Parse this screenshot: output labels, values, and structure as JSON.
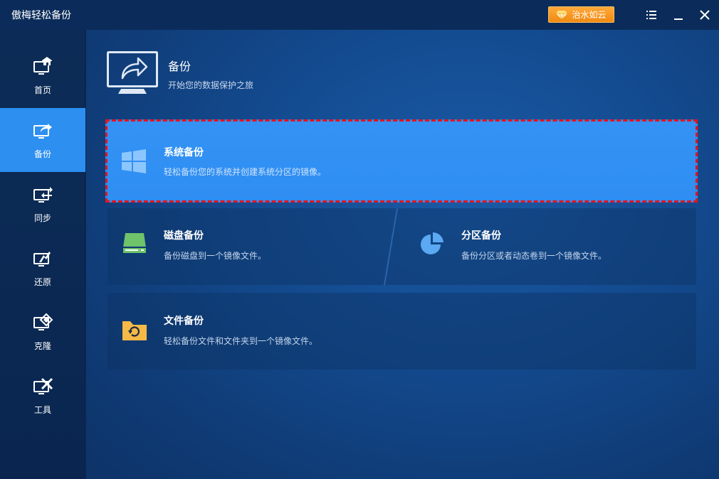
{
  "app": {
    "title": "傲梅轻松备份",
    "upgrade_label": "治水如云",
    "accent": "#2d8ff0",
    "upgrade_color": "#f49a1c",
    "highlight_border": "#e3141e"
  },
  "window_controls": {
    "menu_icon": "menu-list-icon",
    "minimize_icon": "minimize-icon",
    "close_icon": "close-icon"
  },
  "sidebar": {
    "items": [
      {
        "label": "首页",
        "icon": "home-icon",
        "active": false
      },
      {
        "label": "备份",
        "icon": "backup-icon",
        "active": true
      },
      {
        "label": "同步",
        "icon": "sync-icon",
        "active": false
      },
      {
        "label": "还原",
        "icon": "restore-icon",
        "active": false
      },
      {
        "label": "克隆",
        "icon": "clone-icon",
        "active": false
      },
      {
        "label": "工具",
        "icon": "tools-icon",
        "active": false
      }
    ]
  },
  "header": {
    "title": "备份",
    "subtitle": "开始您的数据保护之旅"
  },
  "options": {
    "system": {
      "title": "系统备份",
      "desc": "轻松备份您的系统并创建系统分区的镜像。",
      "icon": "windows-icon"
    },
    "disk": {
      "title": "磁盘备份",
      "desc": "备份磁盘到一个镜像文件。",
      "icon": "disk-icon"
    },
    "partition": {
      "title": "分区备份",
      "desc": "备份分区或者动态卷到一个镜像文件。",
      "icon": "pie-partition-icon"
    },
    "file": {
      "title": "文件备份",
      "desc": "轻松备份文件和文件夹到一个镜像文件。",
      "icon": "folder-sync-icon"
    }
  }
}
